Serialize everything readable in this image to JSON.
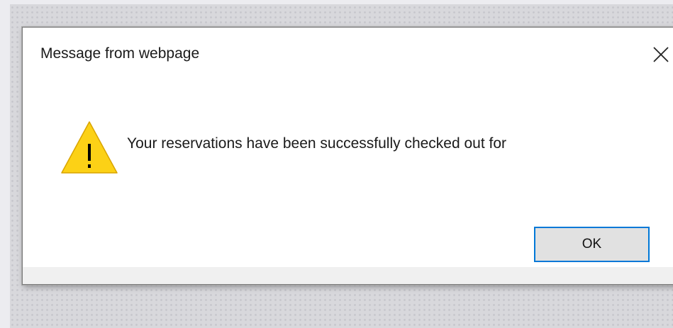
{
  "dialog": {
    "title": "Message from webpage",
    "message": "Your reservations have been successfully checked out for",
    "ok_label": "OK",
    "icon": "warning-icon",
    "close_icon": "close-icon"
  },
  "colors": {
    "focus_border": "#0078d7",
    "warning_fill": "#fcd116",
    "button_bg": "#e1e1e1"
  }
}
